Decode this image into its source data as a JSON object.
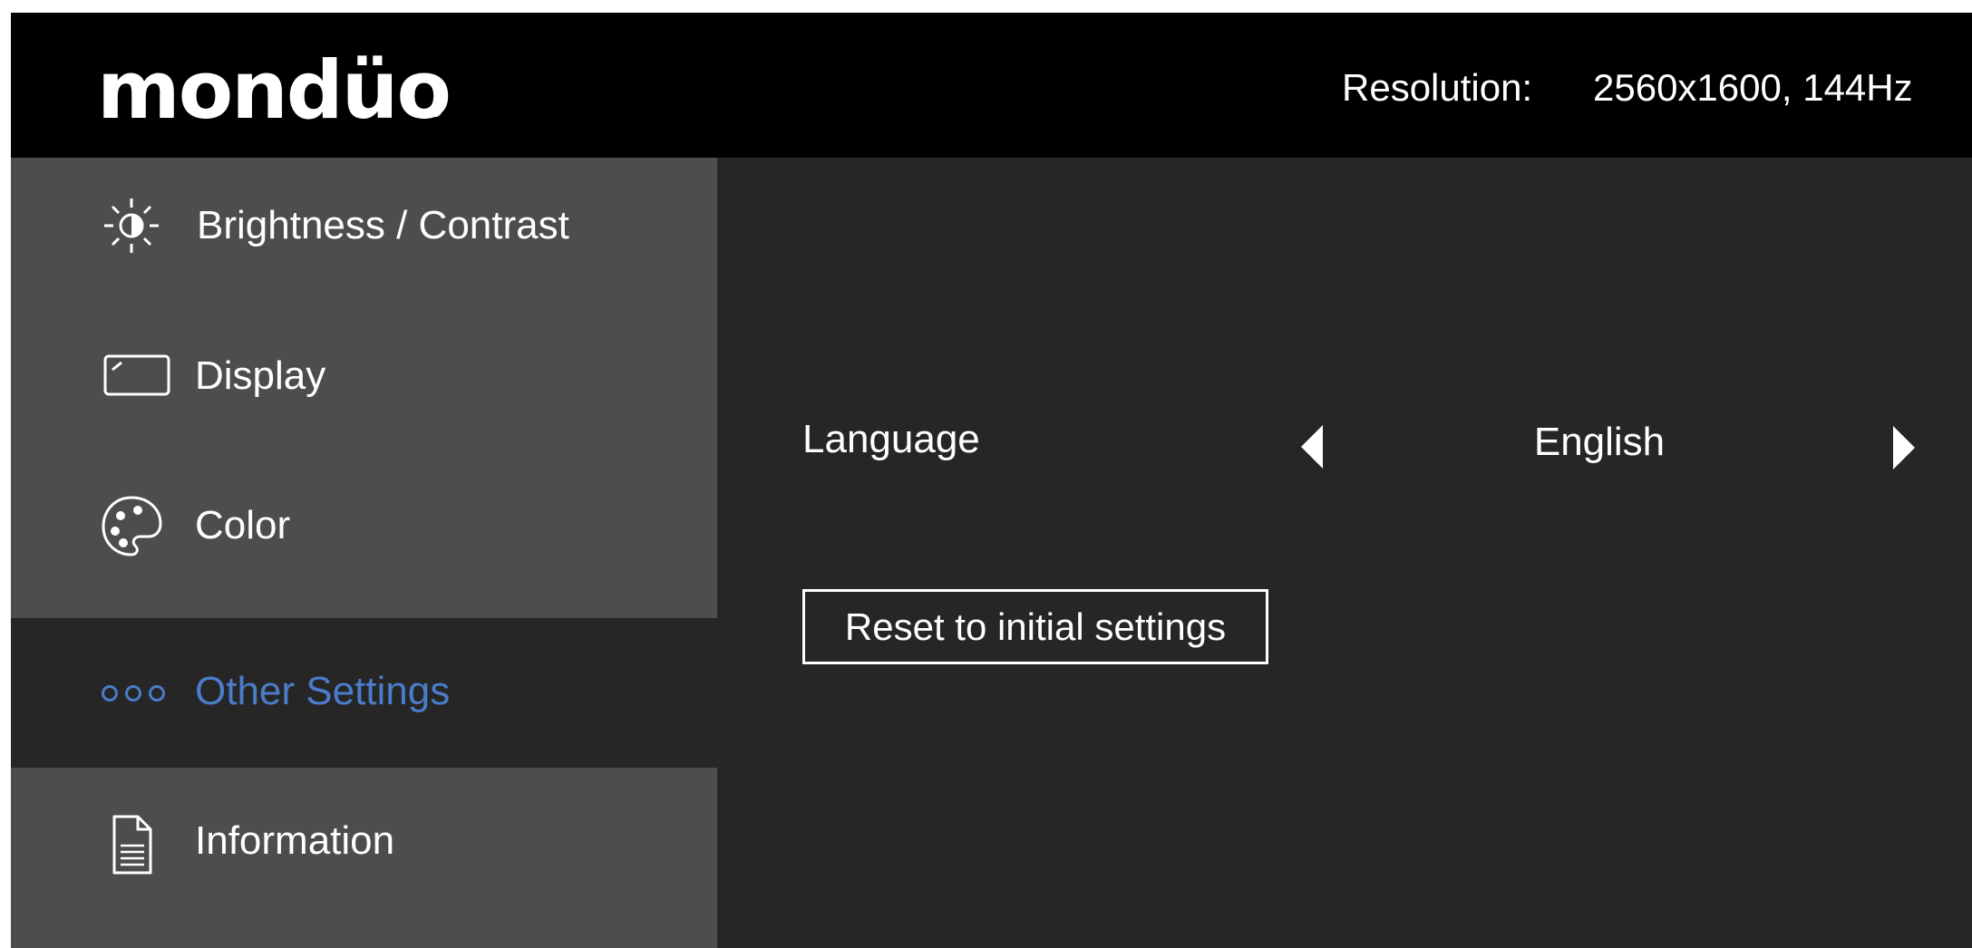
{
  "header": {
    "logo_text": "mondüo",
    "logo_mark": "®",
    "resolution_label": "Resolution:",
    "resolution_value": "2560x1600, 144Hz"
  },
  "sidebar": {
    "items": [
      {
        "label": "Brightness / Contrast",
        "icon": "brightness-icon",
        "active": false
      },
      {
        "label": "Display",
        "icon": "display-icon",
        "active": false
      },
      {
        "label": "Color",
        "icon": "palette-icon",
        "active": false
      },
      {
        "label": "Other Settings",
        "icon": "more-dots-icon",
        "active": true
      },
      {
        "label": "Information",
        "icon": "document-icon",
        "active": false
      }
    ]
  },
  "main": {
    "language_label": "Language",
    "language_value": "English",
    "reset_label": "Reset to initial settings"
  },
  "colors": {
    "header_bg": "#000000",
    "sidebar_bg": "#4d4d4d",
    "content_bg": "#262626",
    "accent": "#4a7cc9",
    "text": "#ffffff"
  }
}
